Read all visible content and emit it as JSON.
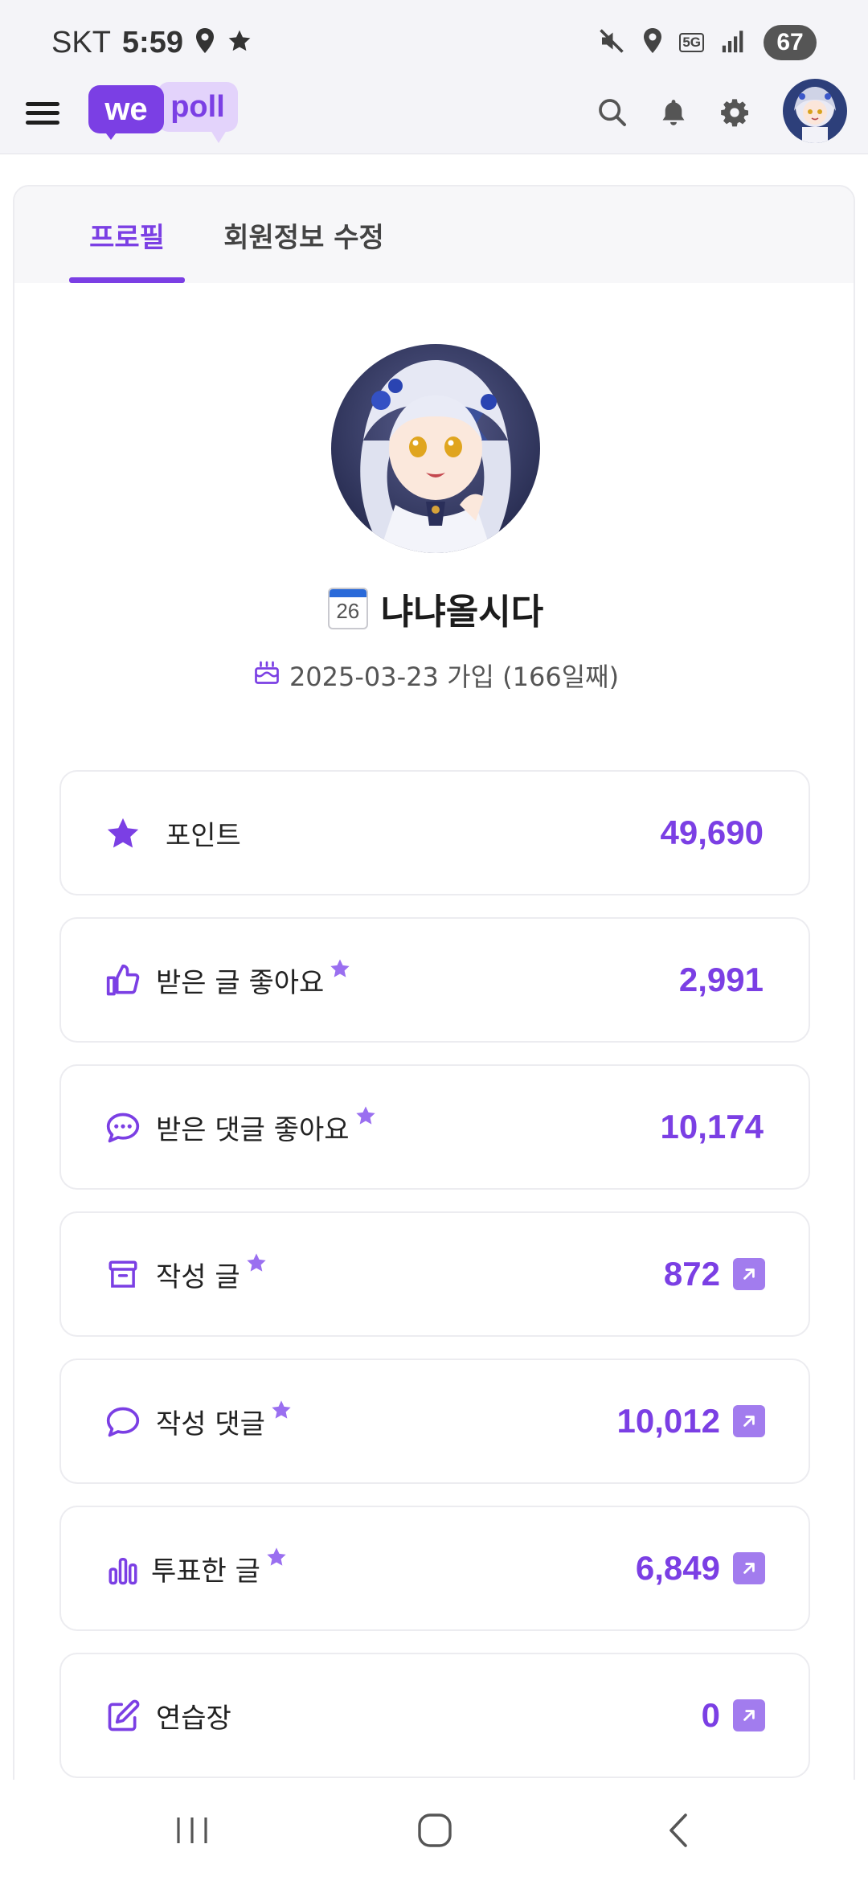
{
  "status_bar": {
    "carrier": "SKT",
    "time": "5:59",
    "network": "5G",
    "battery": "67"
  },
  "header": {
    "logo_we": "we",
    "logo_poll": "poll",
    "icons": [
      "menu-icon",
      "search-icon",
      "bell-icon",
      "gear-icon",
      "avatar"
    ]
  },
  "tabs": [
    {
      "label": "프로필",
      "active": true
    },
    {
      "label": "회원정보 수정",
      "active": false
    }
  ],
  "profile": {
    "calendar_day": "26",
    "username": "냐냐올시다",
    "join_text": "2025-03-23 가입 (166일째)"
  },
  "stats": [
    {
      "label": "포인트",
      "value": "49,690",
      "icon": "star-icon"
    },
    {
      "label": "받은 글 좋아요",
      "value": "2,991",
      "icon": "thumbs-up-icon"
    },
    {
      "label": "받은 댓글 좋아요",
      "value": "10,174",
      "icon": "chat-dots-icon"
    },
    {
      "label": "작성 글",
      "value": "872",
      "icon": "archive-icon"
    },
    {
      "label": "작성 댓글",
      "value": "10,012",
      "icon": "comment-icon"
    },
    {
      "label": "투표한 글",
      "value": "6,849",
      "icon": "bar-chart-icon"
    },
    {
      "label": "연습장",
      "value": "0",
      "icon": "edit-icon"
    }
  ],
  "colors": {
    "accent": "#7b3fe4",
    "accent_light": "#a27cee",
    "logo_light": "#e3d3fb"
  }
}
